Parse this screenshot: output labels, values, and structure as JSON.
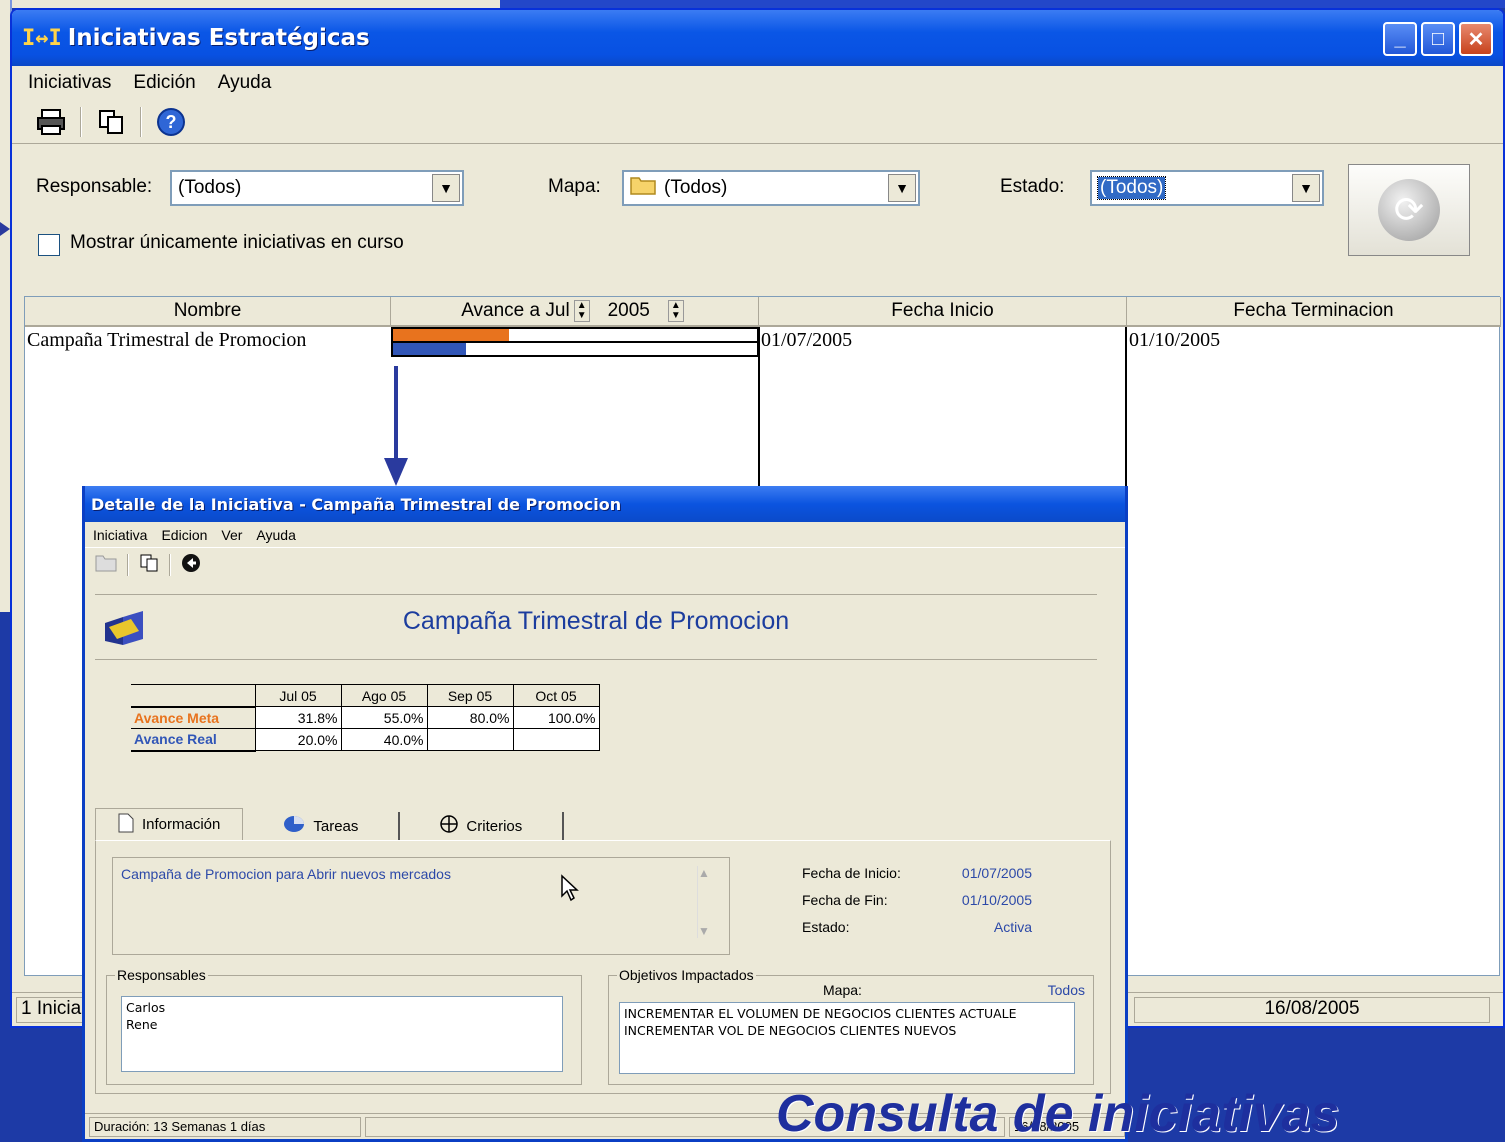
{
  "main": {
    "title": "Iniciativas Estratégicas",
    "menu": [
      "Iniciativas",
      "Edición",
      "Ayuda"
    ],
    "filters": {
      "responsable_label": "Responsable:",
      "responsable_value": "(Todos)",
      "mapa_label": "Mapa:",
      "mapa_value": "(Todos)",
      "estado_label": "Estado:",
      "estado_value": "(Todos)",
      "only_current_label": "Mostrar únicamente iniciativas en curso"
    },
    "grid": {
      "col_nombre": "Nombre",
      "col_avance_prefix": "Avance a",
      "avance_month": "Jul",
      "avance_year": "2005",
      "col_fecha_inicio": "Fecha Inicio",
      "col_fecha_fin": "Fecha Terminacion",
      "rows": [
        {
          "nombre": "Campaña Trimestral de Promocion",
          "fecha_inicio": "01/07/2005",
          "fecha_fin": "01/10/2005",
          "avance_meta": 0.318,
          "avance_real": 0.2
        }
      ]
    },
    "status": {
      "left": "1 Inicia",
      "date": "16/08/2005"
    },
    "colors": {
      "meta": "#e8731e",
      "real": "#3156b7"
    }
  },
  "detail": {
    "title": "Detalle de la Iniciativa - Campaña Trimestral de Promocion",
    "menu": [
      "Iniciativa",
      "Edicion",
      "Ver",
      "Ayuda"
    ],
    "heading": "Campaña Trimestral de Promocion",
    "table": {
      "months": [
        "Jul 05",
        "Ago 05",
        "Sep 05",
        "Oct 05"
      ],
      "meta_label": "Avance Meta",
      "meta": [
        "31.8%",
        "55.0%",
        "80.0%",
        "100.0%"
      ],
      "real_label": "Avance Real",
      "real": [
        "20.0%",
        "40.0%",
        "",
        ""
      ]
    },
    "tabs": [
      "Información",
      "Tareas",
      "Criterios"
    ],
    "description": "Campaña de Promocion para Abrir nuevos mercados",
    "info": {
      "inicio_label": "Fecha de Inicio:",
      "inicio": "01/07/2005",
      "fin_label": "Fecha de Fin:",
      "fin": "01/10/2005",
      "estado_label": "Estado:",
      "estado": "Activa"
    },
    "responsables_title": "Responsables",
    "responsables": [
      "Carlos",
      "Rene"
    ],
    "objetivos_title": "Objetivos Impactados",
    "mapa_label": "Mapa:",
    "mapa_value": "Todos",
    "objetivos": [
      "INCREMENTAR EL VOLUMEN DE NEGOCIOS CLIENTES ACTUALE",
      "INCREMENTAR VOL DE NEGOCIOS CLIENTES NUEVOS"
    ],
    "status": {
      "duracion": "Duración:  13 Semanas 1 días",
      "right": "16/08/2005"
    }
  },
  "caption": "Consulta de iniciativas"
}
